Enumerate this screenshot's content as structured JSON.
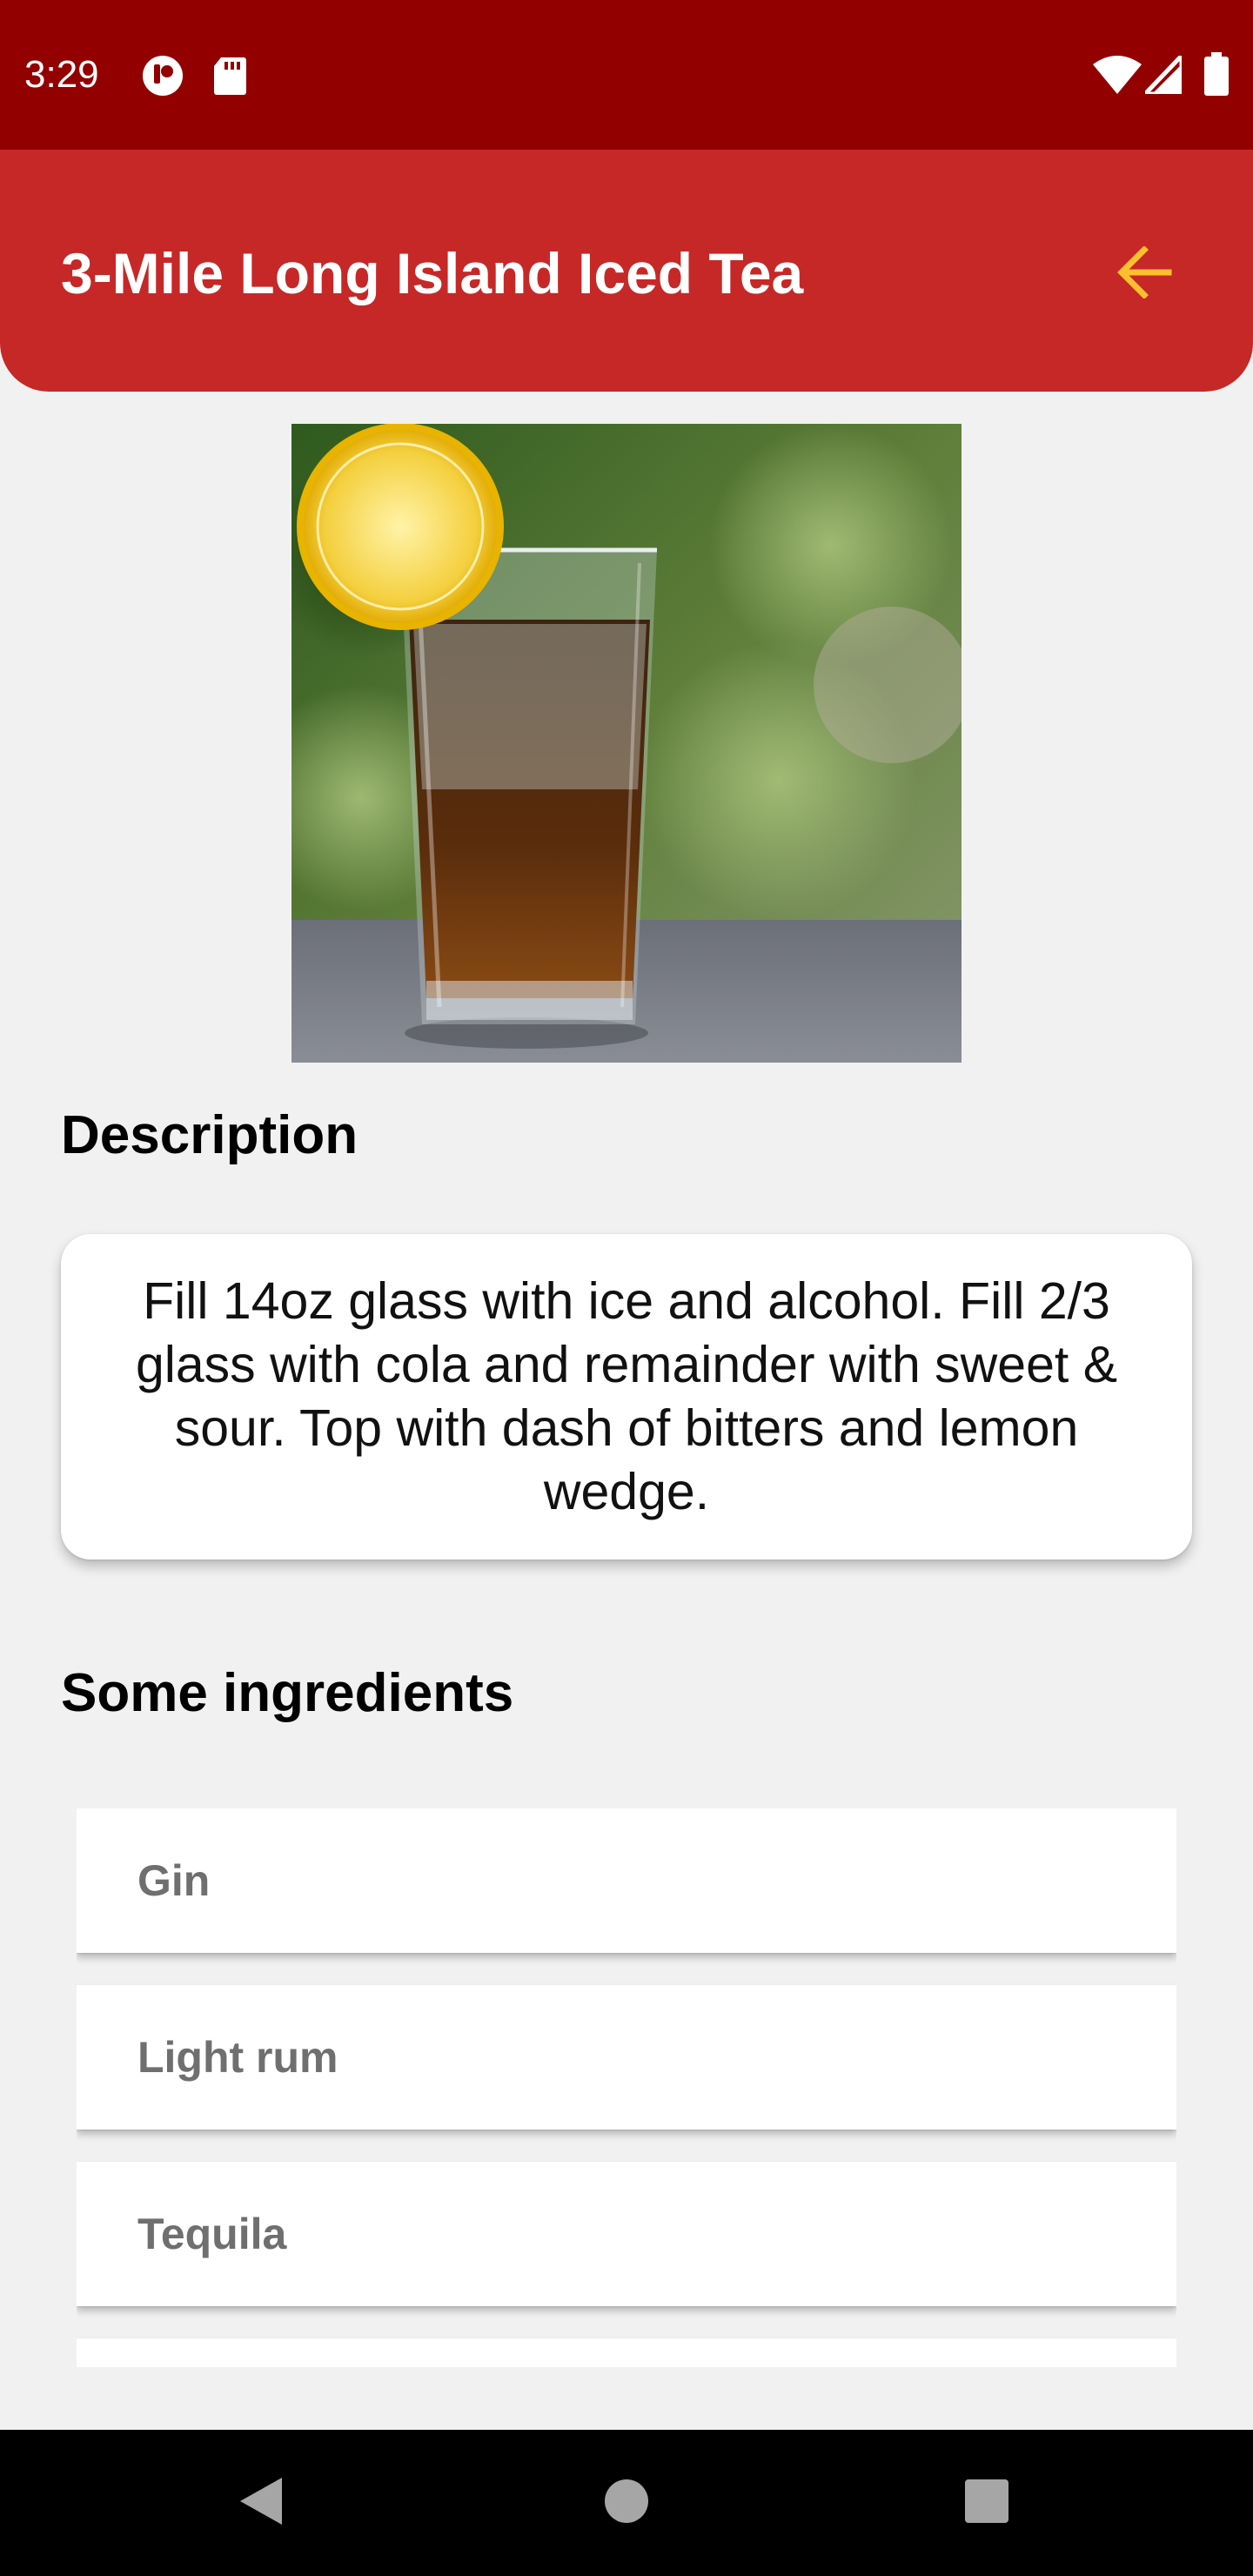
{
  "status_bar": {
    "time": "3:29",
    "icons": [
      "notification-app-icon",
      "sd-card-icon",
      "wifi-icon",
      "cell-signal-icon",
      "battery-icon"
    ]
  },
  "app_bar": {
    "title": "3-Mile Long Island Iced Tea",
    "back_icon": "arrow-left-icon",
    "colors": {
      "background": "#c62828",
      "status": "#930000",
      "accent": "#fbc02d"
    }
  },
  "drink_image": {
    "subject": "drink-photo"
  },
  "description": {
    "heading": "Description",
    "text": "Fill 14oz glass with ice and alcohol. Fill 2/3 glass with cola and remainder with sweet & sour. Top with dash of bitters and lemon wedge."
  },
  "ingredients": {
    "heading": "Some ingredients",
    "items": [
      {
        "label": "Gin"
      },
      {
        "label": "Light rum"
      },
      {
        "label": "Tequila"
      },
      {
        "label": ""
      }
    ]
  },
  "nav_bar": {
    "buttons": [
      "back-triangle-icon",
      "home-circle-icon",
      "recents-square-icon"
    ]
  }
}
